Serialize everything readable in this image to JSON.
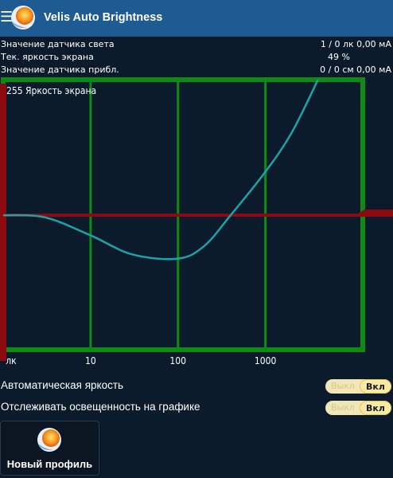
{
  "header": {
    "title": "Velis Auto Brightness",
    "menu_icon": "hamburger-menu-icon",
    "logo_icon": "sun-globe-icon"
  },
  "info": [
    {
      "label": "Значение датчика света",
      "value": "1 / 0 лк 0,00 мА"
    },
    {
      "label": "Тек. яркость экрана",
      "value": "49 %"
    },
    {
      "label": "Значение датчика прибл.",
      "value": "0 / 0 см 0,00 мА"
    }
  ],
  "chart_data": {
    "type": "line",
    "ylabel": "255 Яркость экрана",
    "x_ticks": [
      "лк",
      "10",
      "100",
      "1000"
    ],
    "x_scale": "log",
    "grid": true,
    "series": [
      {
        "x": [
          1,
          3,
          10,
          30,
          100,
          200,
          400,
          1000,
          2000,
          4000
        ],
        "y": [
          127,
          125,
          108,
          90,
          86,
          98,
          127,
          168,
          205,
          255
        ]
      }
    ],
    "reference_line_y": 127,
    "ylim": [
      0,
      255
    ],
    "xlim": [
      1,
      13000
    ],
    "colors": {
      "grid": "#0e8a15",
      "curve": "#1ca3a6",
      "reference": "#8b0b10",
      "background": "#0c1b2c"
    }
  },
  "settings": {
    "auto_brightness": {
      "label": "Автоматическая яркость",
      "off": "Выкл",
      "on": "Вкл"
    },
    "track_on_graph": {
      "label": "Отслеживать освещенность на графике",
      "off": "Выкл",
      "on": "Вкл"
    }
  },
  "profile_button": {
    "label": "Новый профиль",
    "icon": "sun-globe-icon"
  }
}
